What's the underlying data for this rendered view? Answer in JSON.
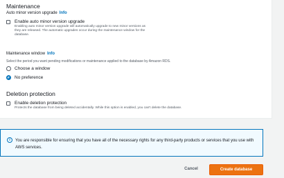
{
  "maintenance": {
    "title": "Maintenance",
    "auto_upgrade_label": "Auto minor version upgrade",
    "info": "Info",
    "enable_auto_upgrade": "Enable auto minor version upgrade",
    "auto_upgrade_desc_1": "Enabling auto minor version upgrade will automatically upgrade to new minor versions as",
    "auto_upgrade_desc_2": "they are released. The automatic upgrades occur during the maintenance window for the",
    "auto_upgrade_desc_3": "database.",
    "auto_upgrade_checked": false,
    "window_label": "Maintenance window",
    "window_desc": "Select the period you want pending modifications or maintenance applied to the database by Amazon RDS.",
    "choose_window": "Choose a window",
    "no_preference": "No preference",
    "selected_option": "No preference"
  },
  "deletion": {
    "title": "Deletion protection",
    "enable_label": "Enable deletion protection",
    "desc": "Protects the database from being deleted accidentally. While this option is enabled, you can't delete the database.",
    "checked": false
  },
  "notice": {
    "icon": "info-icon",
    "text": "You are responsible for ensuring that you have all of the necessary rights for any third-party products or services that you use with AWS services."
  },
  "actions": {
    "cancel": "Cancel",
    "create": "Create database"
  },
  "colors": {
    "accent": "#0073bb",
    "primary_button": "#ec7211"
  }
}
